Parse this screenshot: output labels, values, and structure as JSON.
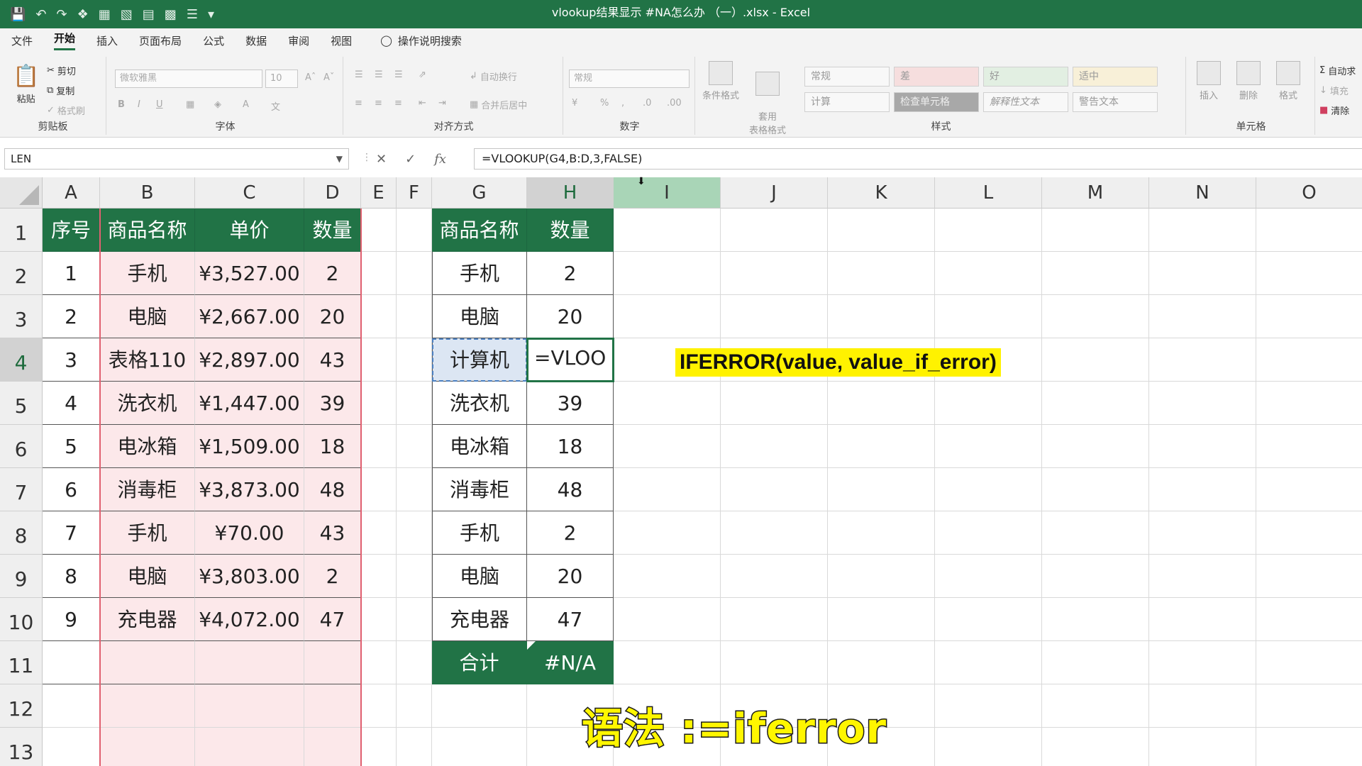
{
  "titlebar": {
    "title": "vlookup结果显示 #NA怎么办 （一）.xlsx  -  Excel"
  },
  "menu": {
    "tabs": [
      "文件",
      "开始",
      "插入",
      "页面布局",
      "公式",
      "数据",
      "审阅",
      "视图"
    ],
    "active": "开始",
    "tellme": "操作说明搜索"
  },
  "ribbon": {
    "clipboard": {
      "label": "剪贴板",
      "paste": "粘贴",
      "cut": "剪切",
      "copy": "复制",
      "format_painter": "格式刷"
    },
    "font": {
      "label": "字体",
      "name": "微软雅黑",
      "size": "10"
    },
    "align": {
      "label": "对齐方式",
      "wrap": "自动换行",
      "merge": "合并后居中"
    },
    "number": {
      "label": "数字",
      "format": "常规"
    },
    "styles": {
      "label": "样式",
      "cond_format": "条件格式",
      "table_format": "套用\n表格格式",
      "cells": [
        "常规",
        "差",
        "好",
        "适中",
        "计算",
        "检查单元格",
        "解释性文本",
        "警告文本"
      ]
    },
    "cells": {
      "label": "单元格",
      "insert": "插入",
      "delete": "删除",
      "format": "格式"
    },
    "editing": {
      "autosum": "自动求",
      "fill": "填充",
      "clear": "清除"
    }
  },
  "formula_bar": {
    "name_box": "LEN",
    "formula": "=VLOOKUP(G4,B:D,3,FALSE)"
  },
  "columns": [
    "A",
    "B",
    "C",
    "D",
    "E",
    "F",
    "G",
    "H",
    "I",
    "J",
    "K",
    "L",
    "M",
    "N",
    "O"
  ],
  "rows": [
    "1",
    "2",
    "3",
    "4",
    "5",
    "6",
    "7",
    "8",
    "9",
    "10",
    "11",
    "12",
    "13"
  ],
  "table1": {
    "headers": [
      "序号",
      "商品名称",
      "单价",
      "数量"
    ],
    "rows": [
      [
        "1",
        "手机",
        "¥3,527.00",
        "2"
      ],
      [
        "2",
        "电脑",
        "¥2,667.00",
        "20"
      ],
      [
        "3",
        "表格110",
        "¥2,897.00",
        "43"
      ],
      [
        "4",
        "洗衣机",
        "¥1,447.00",
        "39"
      ],
      [
        "5",
        "电冰箱",
        "¥1,509.00",
        "18"
      ],
      [
        "6",
        "消毒柜",
        "¥3,873.00",
        "48"
      ],
      [
        "7",
        "手机",
        "¥70.00",
        "43"
      ],
      [
        "8",
        "电脑",
        "¥3,803.00",
        "2"
      ],
      [
        "9",
        "充电器",
        "¥4,072.00",
        "47"
      ]
    ]
  },
  "table2": {
    "headers": [
      "商品名称",
      "数量"
    ],
    "rows": [
      [
        "手机",
        "2"
      ],
      [
        "电脑",
        "20"
      ],
      [
        "计算机",
        "=VLOO"
      ],
      [
        "洗衣机",
        "39"
      ],
      [
        "电冰箱",
        "18"
      ],
      [
        "消毒柜",
        "48"
      ],
      [
        "手机",
        "2"
      ],
      [
        "电脑",
        "20"
      ],
      [
        "充电器",
        "47"
      ]
    ],
    "total_label": "合计",
    "total_value": "#N/A"
  },
  "tooltip": "IFERROR(value, value_if_error)",
  "subtitle": "语法 :=iferror",
  "colors": {
    "excel_green": "#217346",
    "pink_fill": "#fce8ea",
    "tooltip_bg": "#fff200",
    "subtitle": "#fff600"
  }
}
